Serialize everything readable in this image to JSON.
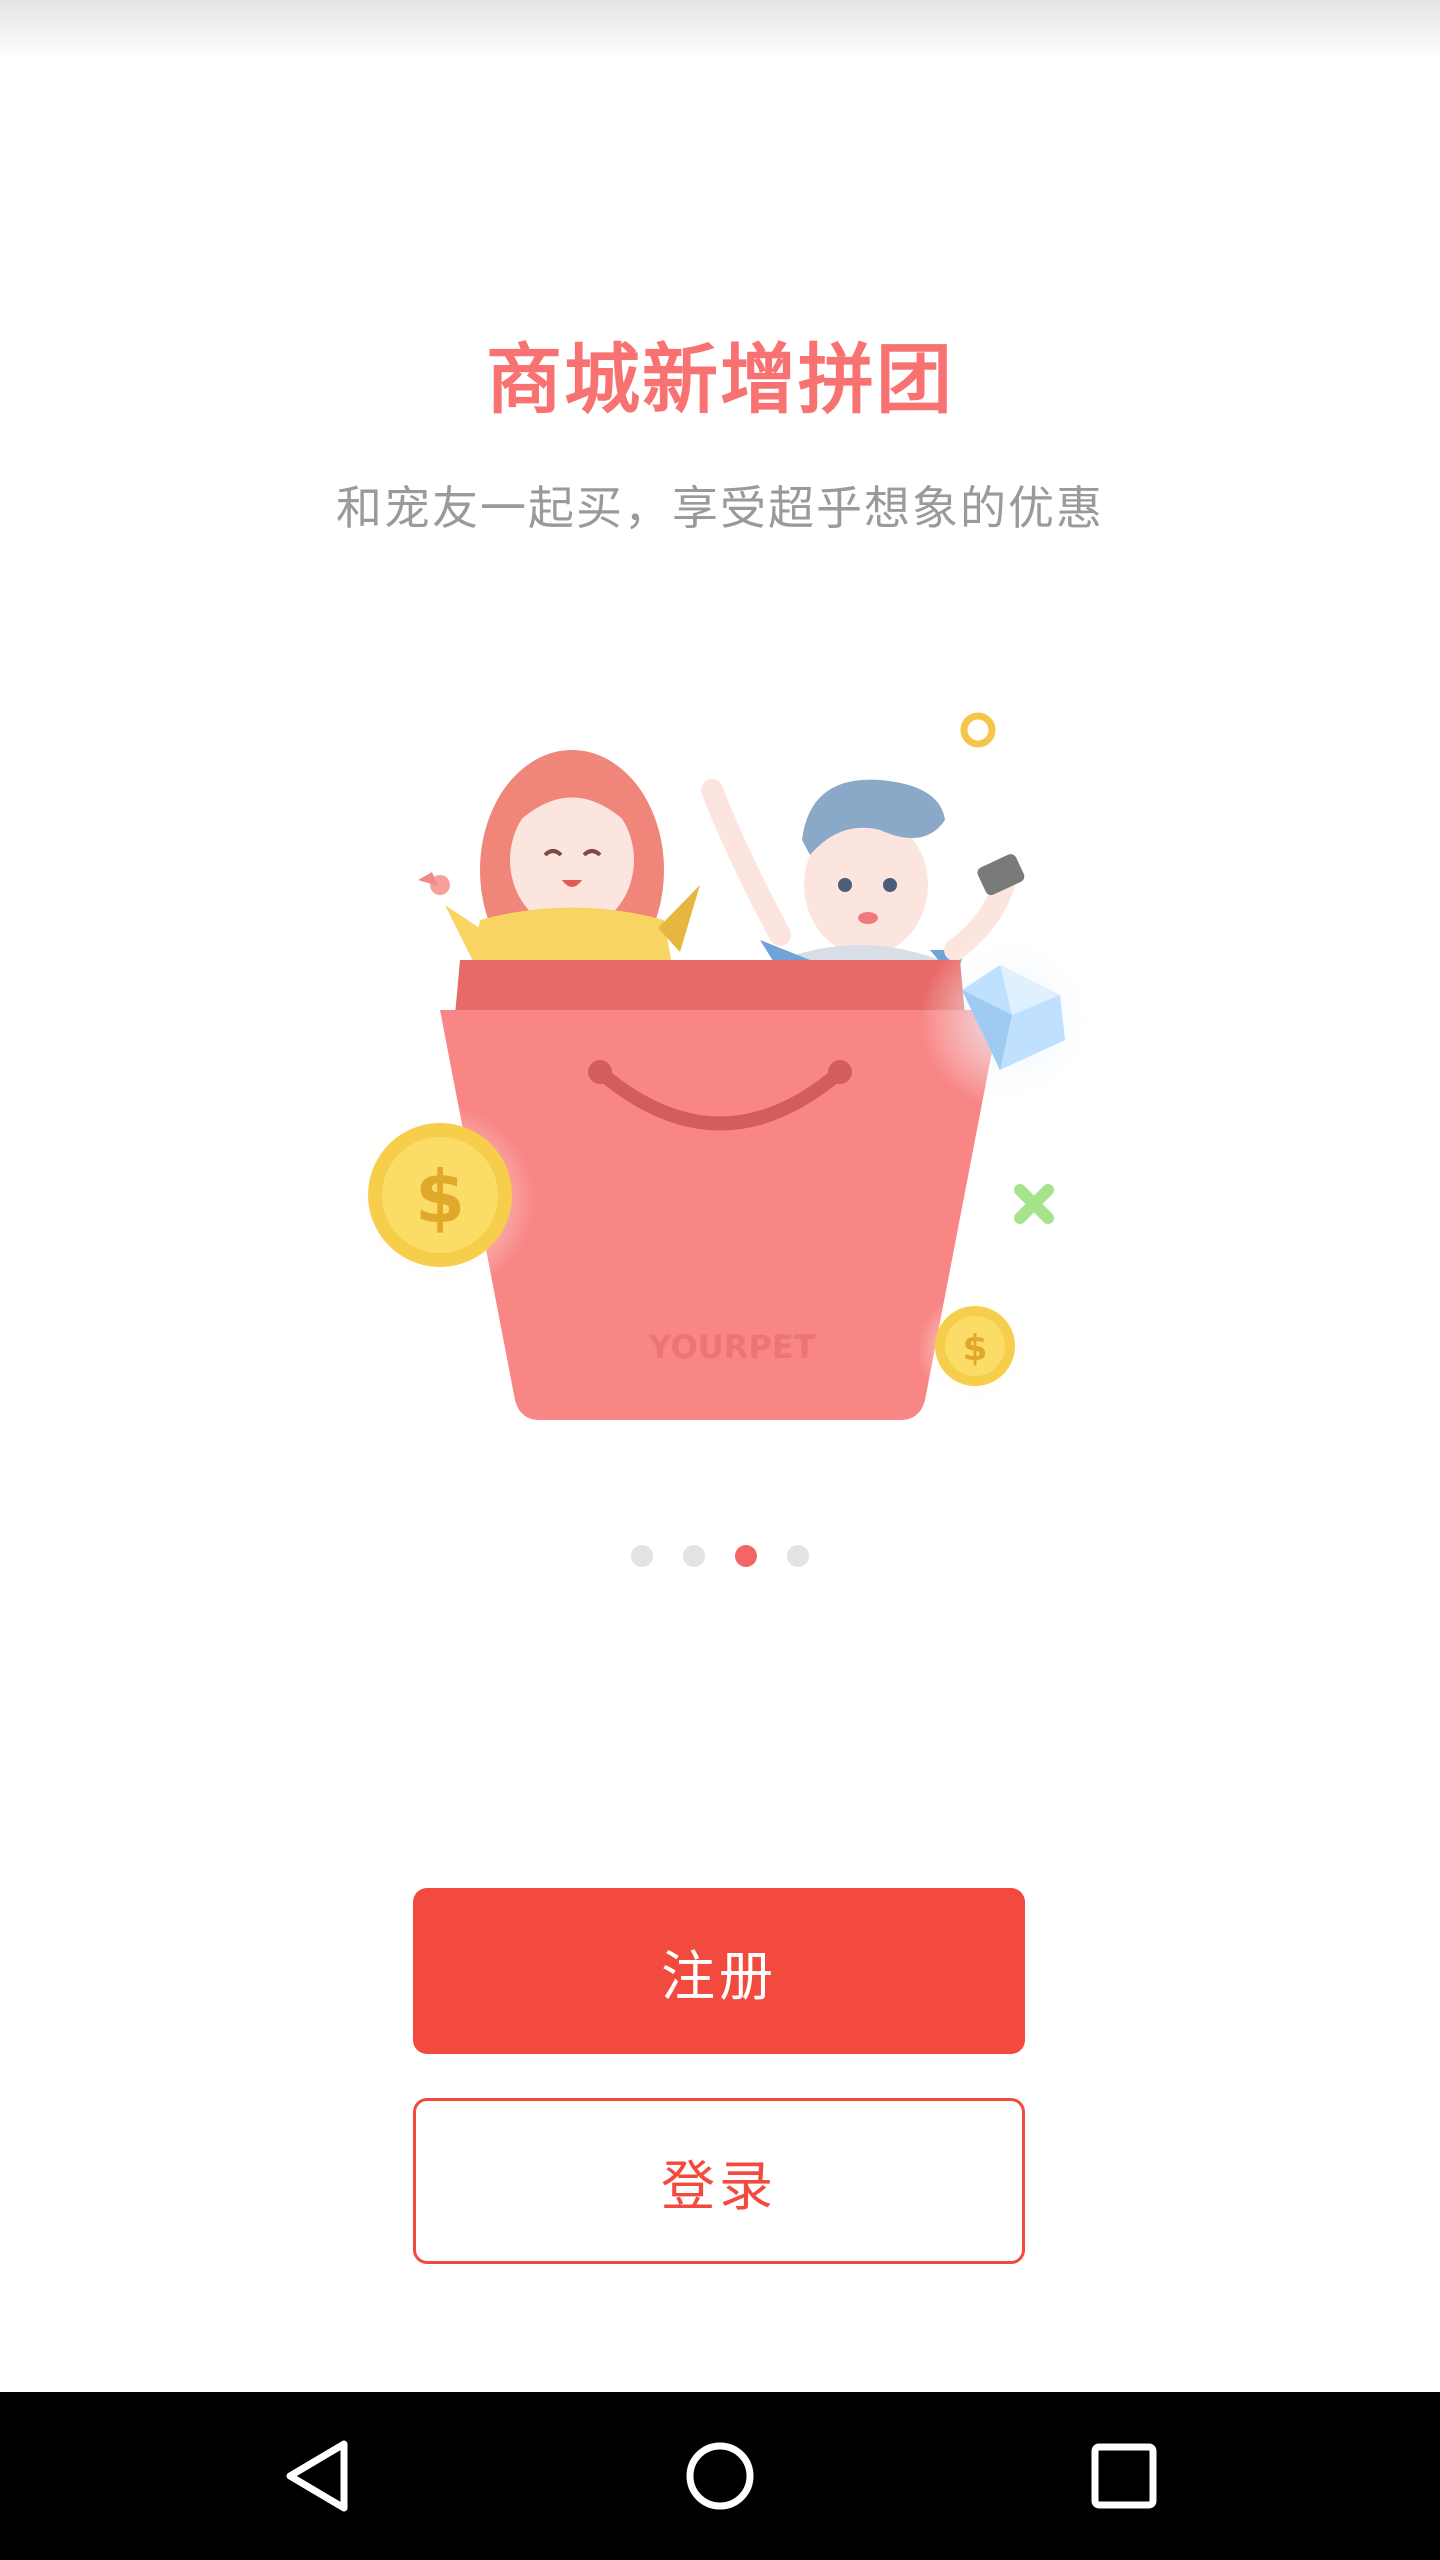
{
  "onboarding": {
    "title": "商城新增拼团",
    "subtitle": "和宠友一起买，享受超乎想象的优惠",
    "illustration": {
      "bag_brand": "YOURPET",
      "coin_symbol": "$"
    },
    "pagination": {
      "total": 4,
      "active_index": 3
    }
  },
  "actions": {
    "register_label": "注册",
    "login_label": "登录"
  },
  "colors": {
    "accent": "#f24a3e",
    "title": "#f87272",
    "subtitle": "#9a9a9a"
  },
  "system_nav": {
    "icons": [
      "back-icon",
      "home-icon",
      "recents-icon"
    ]
  }
}
